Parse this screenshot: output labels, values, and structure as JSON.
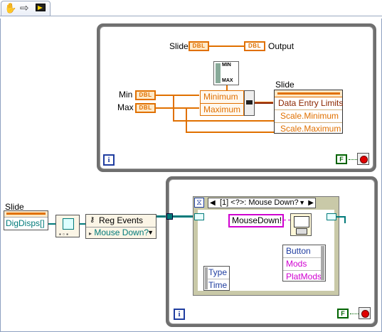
{
  "toolbar": {
    "icons": [
      "hand-icon",
      "arrow-icon",
      "run-icon"
    ]
  },
  "top_loop": {
    "slide_label": "Slide",
    "output_label": "Output",
    "dbl_tag": "DBL",
    "minmax_icon_text": [
      "MIN",
      "MAX"
    ],
    "min_label": "Min",
    "max_label": "Max",
    "bundle_rows": [
      "Minimum",
      "Maximum"
    ],
    "property_node": {
      "label": "Slide",
      "rows": [
        "Data Entry Limits",
        "Scale.Minimum",
        "Scale.Maximum"
      ]
    },
    "iteration": "i",
    "stop_const": "F"
  },
  "bottom_outer": {
    "slide_label": "Slide",
    "terminal_text": "DigDisps[]",
    "reg_events": {
      "title": "Reg Events",
      "item": "Mouse Down?"
    }
  },
  "bottom_loop": {
    "case_header": "[1] <?>: Mouse Down?",
    "string_const": "MouseDown!",
    "event_data_left": [
      "Type",
      "Time"
    ],
    "event_data_right": [
      "Button",
      "Mods",
      "PlatMods"
    ],
    "hourglass": "⧖",
    "iteration": "i",
    "stop_const": "F"
  },
  "colors": {
    "double": "#e07000",
    "refnum": "#007a7a",
    "loop_border": "#6f6f6f",
    "iteration_blue": "#1f3da0",
    "boolean_green": "#006400",
    "string_pink": "#d000d0"
  }
}
